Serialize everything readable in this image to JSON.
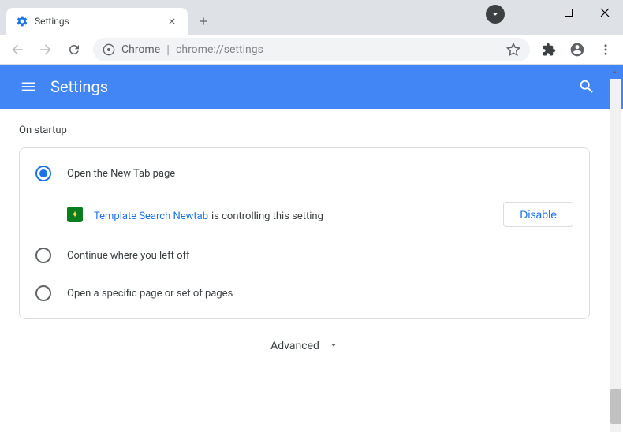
{
  "window": {
    "tab_title": "Settings"
  },
  "toolbar": {
    "url_prefix": "Chrome",
    "url_path": "chrome://settings"
  },
  "header": {
    "title": "Settings"
  },
  "content": {
    "section_title": "On startup",
    "radio_options": [
      {
        "label": "Open the New Tab page",
        "selected": true
      },
      {
        "label": "Continue where you left off",
        "selected": false
      },
      {
        "label": "Open a specific page or set of pages",
        "selected": false
      }
    ],
    "extension": {
      "name": "Template Search Newtab",
      "description": "is controlling this setting",
      "disable_label": "Disable"
    },
    "advanced_label": "Advanced"
  }
}
